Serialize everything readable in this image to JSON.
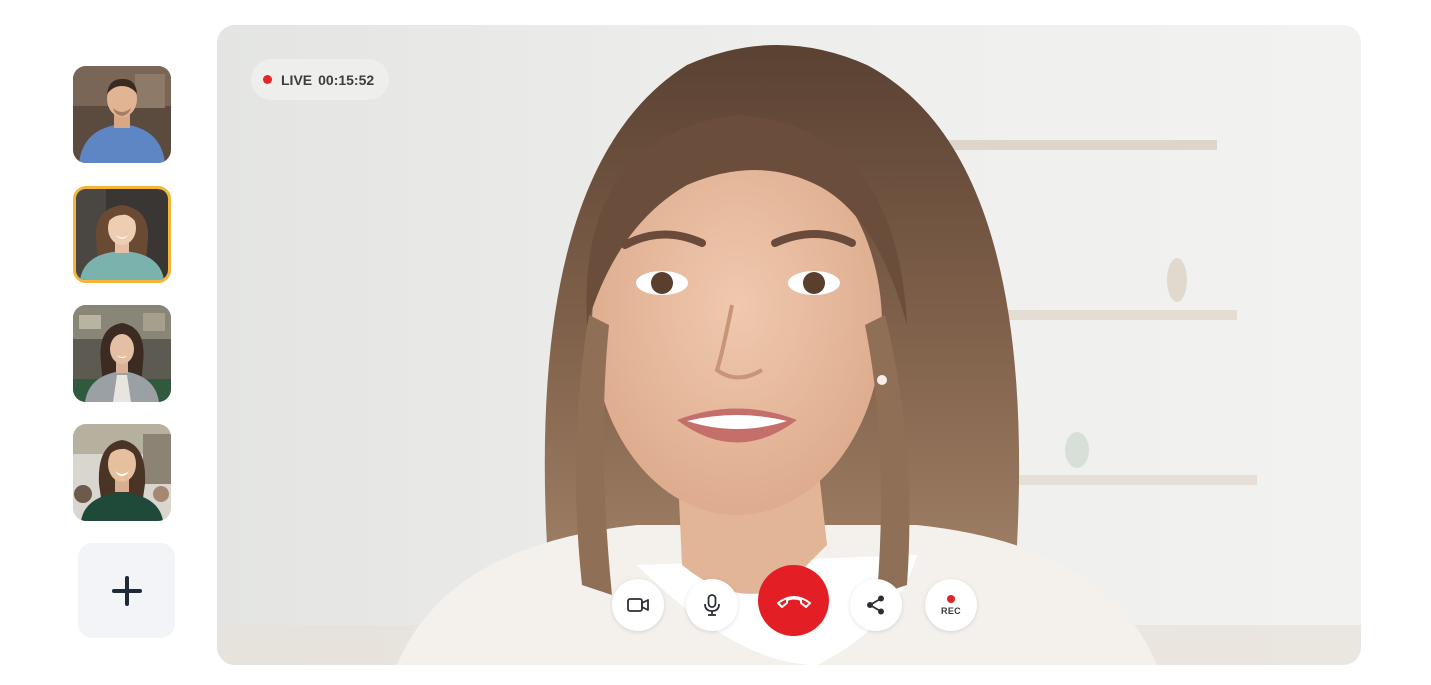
{
  "call": {
    "live_label": "LIVE",
    "timer": "00:15:52",
    "rec_label": "REC"
  },
  "sidebar": {
    "participants": [
      {
        "avatar": "man-blue-shirt",
        "active": false
      },
      {
        "avatar": "woman-teal-top",
        "active": true
      },
      {
        "avatar": "woman-grey-cardigan",
        "active": false
      },
      {
        "avatar": "woman-dark-green-top",
        "active": false
      }
    ],
    "add_icon": "plus-icon"
  },
  "controls": [
    "camera-icon",
    "microphone-icon",
    "end-call-icon",
    "share-icon",
    "record-icon"
  ],
  "colors": {
    "accent_active": "#f4b63a",
    "end_call": "#e31e24",
    "live_dot": "#e3242b",
    "add_button_bg": "#f2f4f7"
  }
}
